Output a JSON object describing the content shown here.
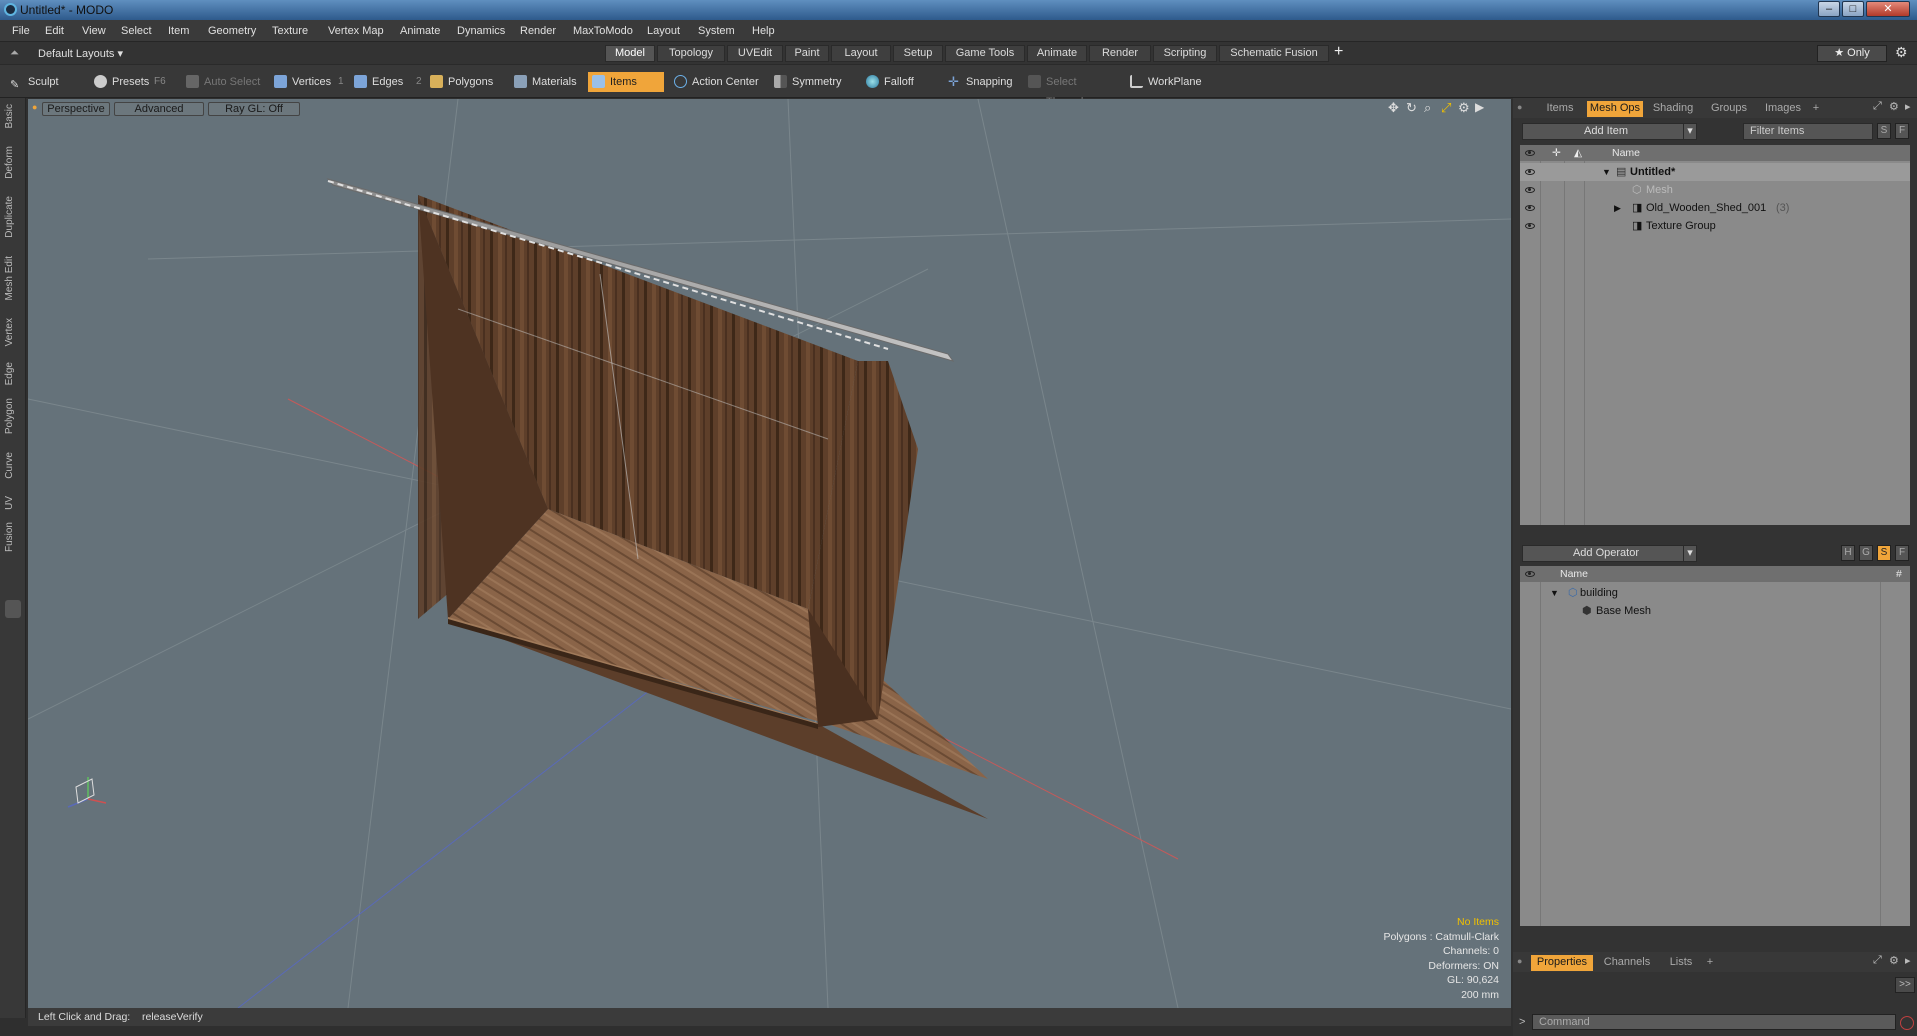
{
  "window": {
    "title": "Untitled* - MODO",
    "minimize": "–",
    "maximize": "□",
    "close": "✕"
  },
  "menu": [
    "File",
    "Edit",
    "View",
    "Select",
    "Item",
    "Geometry",
    "Texture",
    "Vertex Map",
    "Animate",
    "Dynamics",
    "Render",
    "MaxToModo",
    "Layout",
    "System",
    "Help"
  ],
  "layoutbar": {
    "layout_select": "Default Layouts ▾",
    "tabs": [
      "Model",
      "Topology",
      "UVEdit",
      "Paint",
      "Layout",
      "Setup",
      "Game Tools",
      "Animate",
      "Render",
      "Scripting",
      "Schematic Fusion"
    ],
    "active_tab": "Model",
    "add": "+",
    "only": "★  Only"
  },
  "toolbar": {
    "sculpt": "Sculpt",
    "presets": "Presets",
    "presets_key": "F6",
    "auto_select": "Auto Select",
    "vertices": "Vertices",
    "vertices_key": "1",
    "edges": "Edges",
    "edges_key": "2",
    "polygons": "Polygons",
    "materials": "Materials",
    "items": "Items",
    "action_center": "Action Center",
    "symmetry": "Symmetry",
    "falloff": "Falloff",
    "snapping": "Snapping",
    "select_through": "Select Through",
    "workplane": "WorkPlane"
  },
  "left_tabs": [
    "Basic",
    "Deform",
    "Duplicate",
    "Mesh Edit",
    "Vertex",
    "Edge",
    "Polygon",
    "Curve",
    "UV",
    "Fusion"
  ],
  "viewport": {
    "view": "Perspective",
    "shading": "Advanced",
    "raygl": "Ray GL: Off",
    "stats": {
      "no_items": "No Items",
      "polygons": "Polygons : Catmull-Clark",
      "channels": "Channels: 0",
      "deformers": "Deformers: ON",
      "gl": "GL: 90,624",
      "grid": "200 mm"
    }
  },
  "status": {
    "hint_label": "Left Click and Drag:",
    "hint_value": "releaseVerify"
  },
  "items_panel": {
    "tabs": [
      "Items",
      "Mesh Ops",
      "Shading",
      "Groups",
      "Images",
      "+"
    ],
    "active_tab": "Mesh Ops",
    "add_item": "Add Item",
    "filter": "Filter Items",
    "btn_s": "S",
    "btn_f": "F",
    "col_name": "Name",
    "rows": [
      {
        "label": "Untitled*",
        "indent": 0
      },
      {
        "label": "Mesh",
        "indent": 1
      },
      {
        "label": "Old_Wooden_Shed_001",
        "count": "(3)",
        "indent": 1
      },
      {
        "label": "Texture Group",
        "indent": 1
      }
    ]
  },
  "meshops_panel": {
    "add_operator": "Add Operator",
    "btns": [
      "H",
      "G",
      "S",
      "F"
    ],
    "col_name": "Name",
    "col_hash": "#",
    "rows": [
      {
        "label": "building",
        "indent": 0
      },
      {
        "label": "Base Mesh",
        "indent": 1
      }
    ]
  },
  "props_panel": {
    "tabs": [
      "Properties",
      "Channels",
      "Lists",
      "+"
    ],
    "active_tab": "Properties",
    "expand": ">>",
    "cmd_prompt": ">",
    "cmd_placeholder": "Command"
  },
  "colors": {
    "accent": "#f0a53a",
    "viewport_bg": "#65727a",
    "wood": "#6b4a33"
  }
}
